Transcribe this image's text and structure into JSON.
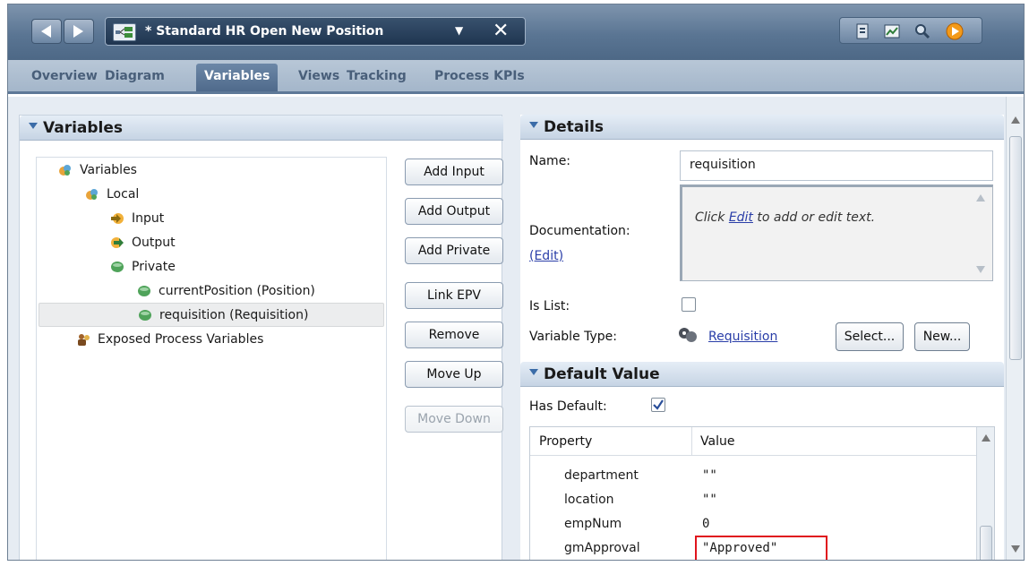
{
  "editor": {
    "title": "* Standard HR Open New Position",
    "dropdown_glyph": "▼",
    "close_glyph": "✕"
  },
  "subtabs": [
    {
      "label": "Overview"
    },
    {
      "label": "Diagram"
    },
    {
      "label": "Variables",
      "active": true
    },
    {
      "label": "Views"
    },
    {
      "label": "Tracking"
    },
    {
      "label": "Process KPIs"
    }
  ],
  "left_section": {
    "title": "Variables",
    "tree": [
      {
        "label": "Variables",
        "icon": "variables-folder-icon",
        "level": 0
      },
      {
        "label": "Local",
        "icon": "local-folder-icon",
        "level": 1
      },
      {
        "label": "Input",
        "icon": "input-arrow-icon",
        "level": 2
      },
      {
        "label": "Output",
        "icon": "output-arrow-icon",
        "level": 2
      },
      {
        "label": "Private",
        "icon": "private-dot-icon",
        "level": 2
      },
      {
        "label": "currentPosition (Position)",
        "icon": "private-dot-icon",
        "level": 3
      },
      {
        "label": "requisition (Requisition)",
        "icon": "private-dot-icon",
        "level": 3,
        "selected": true
      },
      {
        "label": "Exposed Process Variables",
        "icon": "exposed-variables-icon",
        "level": 1
      }
    ],
    "buttons": {
      "add_input": "Add Input",
      "add_output": "Add Output",
      "add_private": "Add Private",
      "link_epv": "Link EPV",
      "remove": "Remove",
      "move_up": "Move Up",
      "move_down": "Move Down"
    }
  },
  "details": {
    "title": "Details",
    "name_label": "Name:",
    "name_value": "requisition",
    "documentation_label": "Documentation:",
    "documentation_edit": "(Edit)",
    "doc_hint_prefix": "Click ",
    "doc_hint_link": "Edit",
    "doc_hint_suffix": " to add or edit text.",
    "is_list_label": "Is List:",
    "is_list_checked": false,
    "variable_type_label": "Variable Type:",
    "variable_type_value": "Requisition",
    "select_button": "Select...",
    "new_button": "New..."
  },
  "default_value": {
    "title": "Default Value",
    "has_default_label": "Has Default:",
    "has_default_checked": true,
    "columns": {
      "property": "Property",
      "value": "Value"
    },
    "rows": [
      {
        "property": "department",
        "value": "\"\""
      },
      {
        "property": "location",
        "value": "\"\""
      },
      {
        "property": "empNum",
        "value": "0"
      },
      {
        "property": "gmApproval",
        "value": "\"Approved\"",
        "highlighted": true
      }
    ]
  },
  "colors": {
    "titlebar": "#5a7593",
    "active_tab": "#4f6a8b",
    "link": "#2a3ea8",
    "highlight_border": "#e0141d"
  }
}
